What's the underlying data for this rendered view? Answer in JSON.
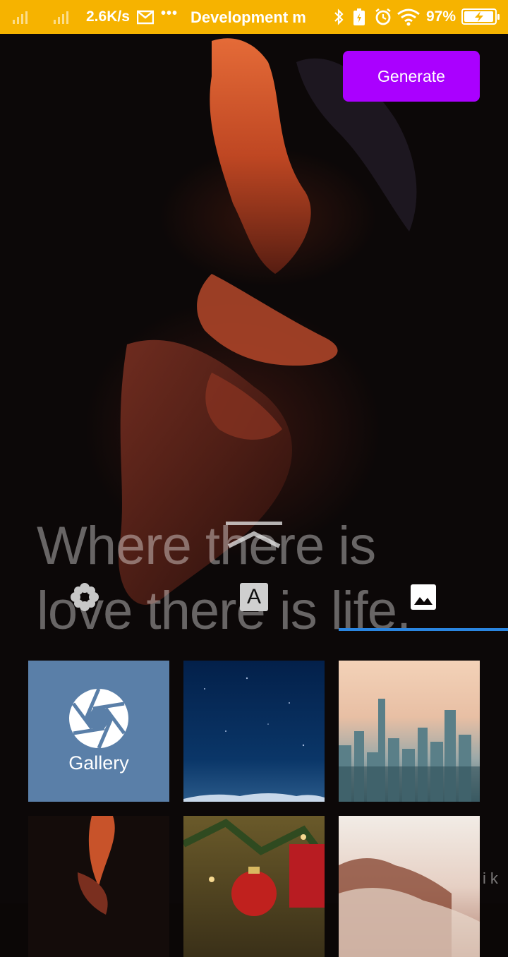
{
  "status_bar": {
    "speed": "2.6K/s",
    "more": "•••",
    "notification": "Development m",
    "battery_percent": "97%",
    "battery_level": 0.97
  },
  "toolbar": {
    "generate_label": "Generate"
  },
  "quote": {
    "line1": "Where there is",
    "line2": "love there is life."
  },
  "tabs": [
    {
      "icon": "flower-icon"
    },
    {
      "icon": "text-format-icon",
      "glyph": "A"
    },
    {
      "icon": "image-icon"
    }
  ],
  "selected_tab": 2,
  "gallery": {
    "label": "Gallery",
    "icon": "aperture-icon"
  },
  "watermark": "ik",
  "colors": {
    "status_bar": "#f6b300",
    "generate_button": "#aa00ff",
    "tab_indicator": "#2a85e0",
    "gallery_tile": "#5a7fa8"
  }
}
